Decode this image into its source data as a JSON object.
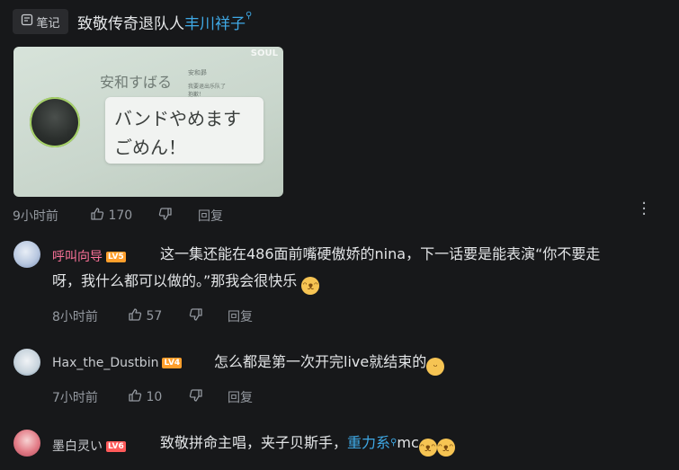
{
  "post": {
    "tag_label": "笔记",
    "title_prefix": "致敬传奇退队人",
    "title_link": "丰川祥子",
    "image": {
      "watermark": "SOUL",
      "speaker": "安和すばる",
      "small_name": "安和昴",
      "small_text_1": "我要退出乐队了",
      "small_text_2": "抱歉！",
      "bubble_line1": "バンドやめます",
      "bubble_line2": "ごめん！"
    },
    "time": "9小时前",
    "likes": "170",
    "reply_label": "回复"
  },
  "comments": [
    {
      "username": "呼叫向导",
      "level": "LV5",
      "text_line1": "这一集还能在486面前嘴硬傲娇的nina，下一话要是能表演“你不要走",
      "text_line2": "呀，我什么都可以做的。”那我会很快乐",
      "time": "8小时前",
      "likes": "57",
      "reply_label": "回复",
      "username_color": "#fb7299",
      "level_color": "#ff9f2c"
    },
    {
      "username": "Hax_the_Dustbin",
      "level": "LV4",
      "text_line1": "怎么都是第一次开完live就结束的",
      "time": "7小时前",
      "likes": "10",
      "reply_label": "回复",
      "username_color": "#c9ccd0",
      "level_color": "#ff9f2c"
    },
    {
      "username": "墨白灵い",
      "level": "LV6",
      "text_prefix": "致敬拼命主唱，夹子贝斯手，",
      "text_link": "重力系",
      "text_suffix": "mc",
      "username_color": "#c9ccd0",
      "level_color": "#ff5a5a"
    }
  ],
  "icons": {
    "note": "note-icon",
    "search": "search-icon",
    "like": "thumb-up-icon",
    "dislike": "thumb-down-icon",
    "more": "more-vertical-icon",
    "emoji": "emoji-icon"
  }
}
